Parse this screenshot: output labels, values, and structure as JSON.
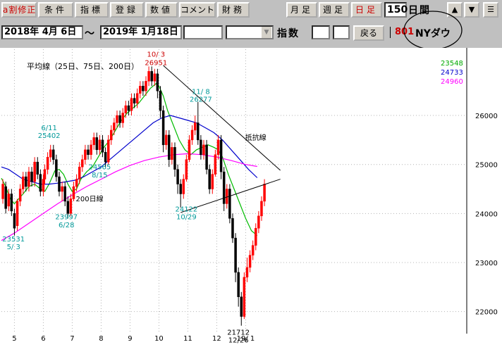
{
  "toolbar": {
    "buttons": [
      {
        "label": "a割修正"
      },
      {
        "label": "条件"
      },
      {
        "label": "指標"
      },
      {
        "label": "登録"
      },
      {
        "label": "数値"
      },
      {
        "label": "コメント"
      },
      {
        "label": "財務"
      },
      {
        "label": "月足"
      },
      {
        "label": "週足"
      },
      {
        "label": "日足"
      }
    ],
    "days_value": "150",
    "days_unit": "日間",
    "up_arrow": "▲",
    "down_arrow": "▼",
    "menu_glyph": "☰"
  },
  "infobar": {
    "start_date": "2018年 4月 6日",
    "separator": "～",
    "end_date": "2019年 1月18日",
    "index_label": "指数",
    "back_label": "戻る",
    "index_code": "801",
    "index_name": "NYダウ"
  },
  "chart_data": {
    "type": "candlestick",
    "title": "",
    "ma_legend": "平均線（25日、75日、200日）",
    "xlim_months": [
      4.55,
      20.6
    ],
    "ylim": [
      21550,
      27350
    ],
    "y_ticks": [
      22000,
      23000,
      24000,
      25000,
      26000
    ],
    "x_ticks": [
      {
        "label": "5",
        "m": 5
      },
      {
        "label": "6",
        "m": 6
      },
      {
        "label": "7",
        "m": 7
      },
      {
        "label": "8",
        "m": 8
      },
      {
        "label": "9",
        "m": 9
      },
      {
        "label": "10",
        "m": 10
      },
      {
        "label": "11",
        "m": 11
      },
      {
        "label": "12",
        "m": 12
      },
      {
        "label": "19/ 1",
        "m": 13
      }
    ],
    "latest_values": [
      {
        "value": "23548",
        "color": "#00aa00"
      },
      {
        "value": "24733",
        "color": "#0000cc"
      },
      {
        "value": "24960",
        "color": "#ff00ff"
      }
    ],
    "series": [
      {
        "name": "25日",
        "color": "#00bb00",
        "points": [
          [
            4.55,
            24720
          ],
          [
            4.7,
            24550
          ],
          [
            4.85,
            24300
          ],
          [
            5.0,
            24200
          ],
          [
            5.15,
            24300
          ],
          [
            5.3,
            24400
          ],
          [
            5.5,
            24550
          ],
          [
            5.7,
            24600
          ],
          [
            5.9,
            24500
          ],
          [
            6.05,
            24450
          ],
          [
            6.2,
            24600
          ],
          [
            6.4,
            24870
          ],
          [
            6.55,
            24900
          ],
          [
            6.7,
            24800
          ],
          [
            6.85,
            24600
          ],
          [
            7.0,
            24450
          ],
          [
            7.15,
            24500
          ],
          [
            7.3,
            24700
          ],
          [
            7.5,
            24850
          ],
          [
            7.7,
            24950
          ],
          [
            7.9,
            25150
          ],
          [
            8.1,
            25350
          ],
          [
            8.3,
            25500
          ],
          [
            8.5,
            25700
          ],
          [
            8.7,
            25900
          ],
          [
            8.9,
            26050
          ],
          [
            9.1,
            26150
          ],
          [
            9.3,
            26250
          ],
          [
            9.5,
            26400
          ],
          [
            9.7,
            26550
          ],
          [
            9.9,
            26650
          ],
          [
            10.0,
            26600
          ],
          [
            10.15,
            26400
          ],
          [
            10.3,
            26100
          ],
          [
            10.5,
            25800
          ],
          [
            10.7,
            25500
          ],
          [
            10.9,
            25300
          ],
          [
            11.1,
            25200
          ],
          [
            11.3,
            25300
          ],
          [
            11.5,
            25350
          ],
          [
            11.7,
            25400
          ],
          [
            11.9,
            25350
          ],
          [
            12.05,
            25300
          ],
          [
            12.2,
            25150
          ],
          [
            12.4,
            24800
          ],
          [
            12.6,
            24500
          ],
          [
            12.8,
            24200
          ],
          [
            13.0,
            23900
          ],
          [
            13.2,
            23650
          ],
          [
            13.4,
            23550
          ]
        ]
      },
      {
        "name": "75日",
        "color": "#0000cc",
        "points": [
          [
            4.55,
            24950
          ],
          [
            4.8,
            24900
          ],
          [
            5.0,
            24820
          ],
          [
            5.3,
            24700
          ],
          [
            5.6,
            24650
          ],
          [
            5.9,
            24600
          ],
          [
            6.2,
            24600
          ],
          [
            6.5,
            24620
          ],
          [
            6.8,
            24650
          ],
          [
            7.1,
            24680
          ],
          [
            7.4,
            24750
          ],
          [
            7.7,
            24850
          ],
          [
            8.0,
            24950
          ],
          [
            8.3,
            25100
          ],
          [
            8.6,
            25250
          ],
          [
            8.9,
            25400
          ],
          [
            9.2,
            25550
          ],
          [
            9.5,
            25700
          ],
          [
            9.8,
            25850
          ],
          [
            10.1,
            25950
          ],
          [
            10.4,
            26000
          ],
          [
            10.7,
            25950
          ],
          [
            11.0,
            25900
          ],
          [
            11.3,
            25850
          ],
          [
            11.6,
            25750
          ],
          [
            11.9,
            25650
          ],
          [
            12.2,
            25500
          ],
          [
            12.5,
            25300
          ],
          [
            12.8,
            25100
          ],
          [
            13.1,
            24900
          ],
          [
            13.4,
            24730
          ]
        ]
      },
      {
        "name": "200日",
        "color": "#ff00ff",
        "points": [
          [
            4.55,
            23450
          ],
          [
            5.0,
            23600
          ],
          [
            5.5,
            23800
          ],
          [
            6.0,
            24000
          ],
          [
            6.5,
            24200
          ],
          [
            7.0,
            24380
          ],
          [
            7.5,
            24550
          ],
          [
            8.0,
            24700
          ],
          [
            8.5,
            24850
          ],
          [
            9.0,
            24980
          ],
          [
            9.5,
            25080
          ],
          [
            10.0,
            25150
          ],
          [
            10.5,
            25200
          ],
          [
            11.0,
            25220
          ],
          [
            11.5,
            25200
          ],
          [
            12.0,
            25150
          ],
          [
            12.5,
            25080
          ],
          [
            13.0,
            25000
          ],
          [
            13.4,
            24960
          ]
        ]
      }
    ],
    "candles": [
      [
        4.6,
        24300,
        24600,
        24200,
        24700
      ],
      [
        4.7,
        24550,
        24100,
        24000,
        24650
      ],
      [
        4.8,
        24150,
        24400,
        24050,
        24500
      ],
      [
        4.9,
        24400,
        24050,
        23950,
        24500
      ],
      [
        5.0,
        24000,
        23700,
        23550,
        24100
      ],
      [
        5.1,
        23750,
        24250,
        23650,
        24300
      ],
      [
        5.2,
        24250,
        24500,
        24150,
        24600
      ],
      [
        5.3,
        24500,
        24750,
        24400,
        24850
      ],
      [
        5.4,
        24750,
        24550,
        24450,
        24850
      ],
      [
        5.5,
        24550,
        24850,
        24450,
        24950
      ],
      [
        5.6,
        24850,
        24650,
        24550,
        24950
      ],
      [
        5.7,
        24650,
        25050,
        24550,
        25150
      ],
      [
        5.8,
        25050,
        24800,
        24700,
        25150
      ],
      [
        5.9,
        24800,
        24450,
        24350,
        24900
      ],
      [
        6.0,
        24450,
        24700,
        24350,
        24800
      ],
      [
        6.05,
        24700,
        24900,
        24600,
        25000
      ],
      [
        6.15,
        24900,
        25150,
        24800,
        25250
      ],
      [
        6.25,
        25150,
        25300,
        25050,
        25400
      ],
      [
        6.35,
        25300,
        25100,
        25000,
        25400
      ],
      [
        6.45,
        25100,
        24750,
        24650,
        25200
      ],
      [
        6.55,
        24750,
        24450,
        24350,
        24850
      ],
      [
        6.65,
        24450,
        24550,
        24250,
        24650
      ],
      [
        6.75,
        24550,
        24250,
        24150,
        24650
      ],
      [
        6.85,
        24250,
        24000,
        23900,
        24350
      ],
      [
        6.95,
        24000,
        24300,
        23950,
        24400
      ],
      [
        7.05,
        24300,
        24550,
        24250,
        24650
      ],
      [
        7.15,
        24550,
        24700,
        24450,
        24800
      ],
      [
        7.25,
        24700,
        24950,
        24600,
        25050
      ],
      [
        7.35,
        24950,
        25100,
        24850,
        25200
      ],
      [
        7.45,
        25100,
        25300,
        25000,
        25400
      ],
      [
        7.55,
        25300,
        25200,
        25100,
        25400
      ],
      [
        7.65,
        25200,
        25400,
        25100,
        25500
      ],
      [
        7.75,
        25400,
        25550,
        25300,
        25650
      ],
      [
        7.85,
        25550,
        25300,
        25200,
        25650
      ],
      [
        7.95,
        25300,
        25500,
        25200,
        25600
      ],
      [
        8.05,
        25500,
        25250,
        25150,
        25600
      ],
      [
        8.15,
        25250,
        25050,
        24950,
        25350
      ],
      [
        8.25,
        25050,
        25500,
        25000,
        25600
      ],
      [
        8.35,
        25500,
        25700,
        25400,
        25800
      ],
      [
        8.45,
        25700,
        25850,
        25600,
        25950
      ],
      [
        8.55,
        25850,
        26000,
        25750,
        26100
      ],
      [
        8.65,
        26000,
        25850,
        25750,
        26100
      ],
      [
        8.75,
        25850,
        26050,
        25750,
        26150
      ],
      [
        8.85,
        26050,
        26200,
        25950,
        26300
      ],
      [
        8.95,
        26200,
        26100,
        26000,
        26300
      ],
      [
        9.05,
        26100,
        26350,
        26000,
        26450
      ],
      [
        9.15,
        26350,
        26250,
        26150,
        26450
      ],
      [
        9.25,
        26250,
        26450,
        26150,
        26550
      ],
      [
        9.35,
        26450,
        26600,
        26350,
        26700
      ],
      [
        9.45,
        26600,
        26500,
        26400,
        26700
      ],
      [
        9.55,
        26500,
        26700,
        26400,
        26800
      ],
      [
        9.65,
        26700,
        26900,
        26600,
        27000
      ],
      [
        9.75,
        26900,
        26700,
        26600,
        27000
      ],
      [
        9.85,
        26700,
        26850,
        26600,
        26951
      ],
      [
        9.95,
        26850,
        26500,
        26350,
        26951
      ],
      [
        10.05,
        26500,
        26100,
        25950,
        26600
      ],
      [
        10.15,
        26100,
        25400,
        25250,
        26200
      ],
      [
        10.25,
        25400,
        25600,
        25300,
        25700
      ],
      [
        10.35,
        25600,
        25100,
        24950,
        25700
      ],
      [
        10.45,
        25100,
        25350,
        25000,
        25450
      ],
      [
        10.55,
        25350,
        24900,
        24750,
        25450
      ],
      [
        10.65,
        24900,
        24600,
        24400,
        25000
      ],
      [
        10.75,
        24600,
        24400,
        24122,
        24700
      ],
      [
        10.85,
        24400,
        24700,
        24300,
        24800
      ],
      [
        10.95,
        24700,
        25100,
        24650,
        25200
      ],
      [
        11.05,
        25100,
        25500,
        25050,
        25600
      ],
      [
        11.15,
        25500,
        25700,
        25400,
        25800
      ],
      [
        11.25,
        25700,
        25850,
        25600,
        26000
      ],
      [
        11.35,
        25850,
        25500,
        25400,
        26277
      ],
      [
        11.45,
        25500,
        25200,
        25100,
        25600
      ],
      [
        11.55,
        25200,
        25400,
        25100,
        25500
      ],
      [
        11.65,
        25400,
        24900,
        24800,
        25500
      ],
      [
        11.75,
        24900,
        24500,
        24400,
        25000
      ],
      [
        11.85,
        24500,
        24800,
        24400,
        24900
      ],
      [
        11.95,
        24800,
        25200,
        24750,
        25300
      ],
      [
        12.05,
        25200,
        25500,
        25100,
        25600
      ],
      [
        12.15,
        25500,
        24850,
        24700,
        25600
      ],
      [
        12.25,
        24850,
        24200,
        24050,
        24950
      ],
      [
        12.35,
        24200,
        24500,
        24100,
        24600
      ],
      [
        12.45,
        24500,
        23900,
        23800,
        24600
      ],
      [
        12.55,
        23900,
        23500,
        23400,
        24000
      ],
      [
        12.65,
        23500,
        22800,
        22600,
        23600
      ],
      [
        12.75,
        22800,
        22300,
        22100,
        22900
      ],
      [
        12.85,
        22300,
        21900,
        21712,
        22400
      ],
      [
        12.95,
        21900,
        22700,
        21850,
        22800
      ],
      [
        13.05,
        22700,
        22900,
        22600,
        23100
      ],
      [
        13.15,
        22900,
        23150,
        22800,
        23250
      ],
      [
        13.25,
        23150,
        23350,
        23050,
        23450
      ],
      [
        13.35,
        23350,
        23700,
        23250,
        23800
      ],
      [
        13.45,
        23700,
        23950,
        23600,
        24050
      ],
      [
        13.55,
        23950,
        24250,
        23850,
        24350
      ],
      [
        13.65,
        24250,
        24600,
        24150,
        24700
      ]
    ],
    "annotations": [
      {
        "text": "10/ 3",
        "color": "#cc0000",
        "m": 9.9,
        "v": 27200
      },
      {
        "text": "26951",
        "color": "#cc0000",
        "m": 9.9,
        "v": 27030
      },
      {
        "text": "11/ 8",
        "color": "#009999",
        "m": 11.45,
        "v": 26440
      },
      {
        "text": "26277",
        "color": "#009999",
        "m": 11.45,
        "v": 26280
      },
      {
        "text": "6/11",
        "color": "#009999",
        "m": 6.2,
        "v": 25700
      },
      {
        "text": "25402",
        "color": "#009999",
        "m": 6.2,
        "v": 25540
      },
      {
        "text": "24565",
        "color": "#009999",
        "m": 7.95,
        "v": 24900
      },
      {
        "text": "8/15",
        "color": "#009999",
        "m": 7.95,
        "v": 24740
      },
      {
        "text": "23997",
        "color": "#009999",
        "m": 6.8,
        "v": 23880
      },
      {
        "text": "6/28",
        "color": "#009999",
        "m": 6.8,
        "v": 23720
      },
      {
        "text": "23531",
        "color": "#009999",
        "m": 4.97,
        "v": 23430
      },
      {
        "text": "5/ 3",
        "color": "#009999",
        "m": 4.97,
        "v": 23270
      },
      {
        "text": "24122",
        "color": "#009999",
        "m": 10.95,
        "v": 24040
      },
      {
        "text": "10/29",
        "color": "#009999",
        "m": 10.95,
        "v": 23880
      },
      {
        "text": "21712",
        "color": "#000000",
        "m": 12.75,
        "v": 21530
      },
      {
        "text": "12/26",
        "color": "#000000",
        "m": 12.75,
        "v": 21370
      },
      {
        "text": "抵抗線",
        "color": "#000000",
        "m": 13.35,
        "v": 25500
      },
      {
        "text": "200日線",
        "color": "#000000",
        "m": 7.6,
        "v": 24250
      }
    ],
    "trendlines": [
      {
        "from": [
          10.15,
          27020
        ],
        "to": [
          14.2,
          24880
        ]
      },
      {
        "from": [
          10.75,
          24020
        ],
        "to": [
          14.2,
          24700
        ]
      }
    ]
  }
}
